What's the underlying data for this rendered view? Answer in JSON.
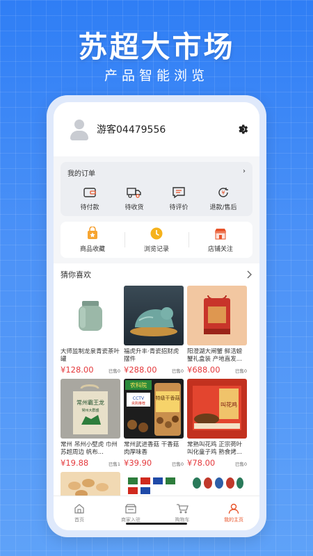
{
  "hero": {
    "title": "苏超大市场",
    "subtitle": "产品智能浏览"
  },
  "profile": {
    "username": "游客04479556",
    "settings_icon": "gear-icon"
  },
  "orders": {
    "title": "我的订单",
    "more": "›",
    "items": [
      {
        "label": "待付款",
        "icon": "wallet-icon"
      },
      {
        "label": "待收货",
        "icon": "truck-icon"
      },
      {
        "label": "待评价",
        "icon": "comment-icon"
      },
      {
        "label": "退款/售后",
        "icon": "refund-icon"
      }
    ]
  },
  "quick": {
    "items": [
      {
        "label": "商品收藏",
        "icon": "star-bag-icon"
      },
      {
        "label": "浏览记录",
        "icon": "clock-icon"
      },
      {
        "label": "店铺关注",
        "icon": "shop-icon"
      }
    ]
  },
  "guess": {
    "title": "猜你喜欢",
    "products": [
      {
        "name": "大师监制龙泉青瓷茶叶罐",
        "price": "¥128.00",
        "sold": "已售0"
      },
      {
        "name": "福虎升丰·青瓷招财虎摆件",
        "price": "¥288.00",
        "sold": "已售0"
      },
      {
        "name": "阳澄湖大闸蟹 鲜活螃蟹礼盒装 产地直发...",
        "price": "¥688.00",
        "sold": "已售0"
      },
      {
        "name": "常州 吊州小壁虎 巾州 苏超周边 帆布...",
        "price": "¥19.88",
        "sold": "已售1"
      },
      {
        "name": "常州武进香菇 干香菇肉厚味香",
        "price": "¥39.90",
        "sold": "已售0"
      },
      {
        "name": "常熟叫花鸡 正宗荷叶叫化童子鸡 熟食烤...",
        "price": "¥78.00",
        "sold": "已售0"
      }
    ],
    "image_texts": {
      "p4_bag_line1": "常州霸王龙",
      "p4_bag_line2": "常州大群盛",
      "p5_badge": "农科院",
      "p5_cctv": "CCTV",
      "p5_cctv_sub": "央购推荐",
      "p5_jar": "特级干香菇",
      "p6_box": "叫花鸡"
    }
  },
  "tabbar": {
    "tabs": [
      {
        "label": "首页",
        "icon": "home-icon"
      },
      {
        "label": "商家入驻",
        "icon": "store-icon"
      },
      {
        "label": "购物车",
        "icon": "cart-icon"
      },
      {
        "label": "我的主页",
        "icon": "person-icon"
      }
    ],
    "active_color": "#e8542a"
  },
  "colors": {
    "price": "#e4393c",
    "accent": "#e8542a",
    "brand_blue": "#2f7ef5"
  }
}
